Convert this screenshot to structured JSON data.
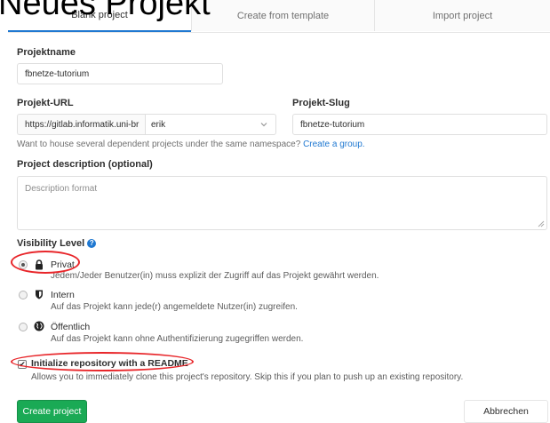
{
  "page": {
    "heading": "Neues Projekt"
  },
  "tabs": [
    {
      "label": "Blank project",
      "active": true
    },
    {
      "label": "Create from template",
      "active": false
    },
    {
      "label": "Import project",
      "active": false
    }
  ],
  "form": {
    "project_name": {
      "label": "Projektname",
      "value": "fbnetze-tutorium"
    },
    "project_url": {
      "label": "Projekt-URL",
      "prefix": "https://gitlab.informatik.uni-br",
      "namespace": "erik"
    },
    "project_slug": {
      "label": "Projekt-Slug",
      "value": "fbnetze-tutorium"
    },
    "namespace_help": {
      "text": "Want to house several dependent projects under the same namespace?",
      "link": "Create a group."
    },
    "description": {
      "label": "Project description (optional)",
      "placeholder": "Description format"
    },
    "visibility": {
      "label": "Visibility Level",
      "help_icon": "?",
      "options": [
        {
          "title": "Privat",
          "desc": "Jedem/Jeder Benutzer(in) muss explizit der Zugriff auf das Projekt gewährt werden.",
          "icon": "lock-icon",
          "selected": true
        },
        {
          "title": "Intern",
          "desc": "Auf das Projekt kann jede(r) angemeldete Nutzer(in) zugreifen.",
          "icon": "shield-icon",
          "selected": false
        },
        {
          "title": "Öffentlich",
          "desc": "Auf das Projekt kann ohne Authentifizierung zugegriffen werden.",
          "icon": "globe-icon",
          "selected": false
        }
      ]
    },
    "readme": {
      "label": "Initialize repository with a README",
      "checked": true,
      "desc": "Allows you to immediately clone this project's repository. Skip this if you plan to push up an existing repository."
    }
  },
  "actions": {
    "create": "Create project",
    "cancel": "Abbrechen"
  },
  "colors": {
    "accent": "#1f78d1",
    "success": "#1aaa55",
    "annotation": "#e8262a"
  }
}
